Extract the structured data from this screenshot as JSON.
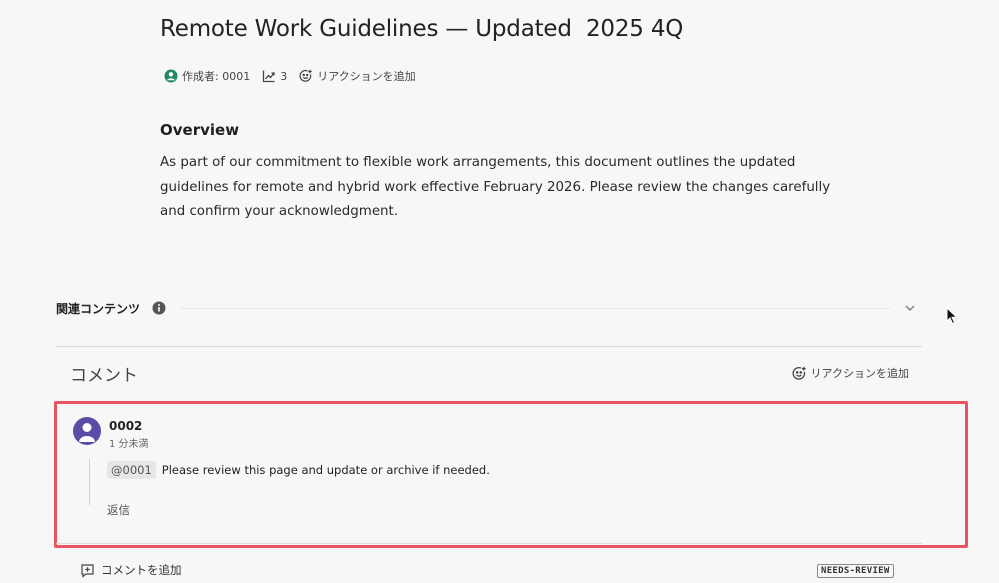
{
  "document": {
    "title": "Remote Work Guidelines — Updated  2025 4Q",
    "meta": {
      "author_label": "作成者: 0001",
      "views_count": "3",
      "add_reaction_label": "リアクションを追加"
    },
    "overview": {
      "heading": "Overview",
      "text": "As part of our commitment to flexible work arrangements, this document outlines the updated guidelines for remote and hybrid work effective February 2026. Please review the changes carefully and confirm your acknowledgment."
    }
  },
  "related_contents": {
    "label": "関連コンテンツ"
  },
  "comments": {
    "title": "コメント",
    "add_reaction_label": "リアクションを追加",
    "items": [
      {
        "author": "0002",
        "timestamp": "1 分未満",
        "mention": "@0001",
        "text": "Please review this page and update or archive if needed.",
        "reply_label": "返信"
      }
    ],
    "add_comment_label": "コメントを追加",
    "status_badge": "NEEDS-REVIEW"
  },
  "colors": {
    "highlight_border": "#e8555f",
    "avatar_bg": "#5b4ca8",
    "author_icon": "#1f8a66"
  },
  "icons": {
    "author": "user-circle-icon",
    "views": "trend-chart-icon",
    "reaction": "add-reaction-icon",
    "info": "info-icon",
    "chevron": "chevron-down-icon",
    "add_comment": "add-comment-icon",
    "cursor": "mouse-cursor-icon"
  }
}
